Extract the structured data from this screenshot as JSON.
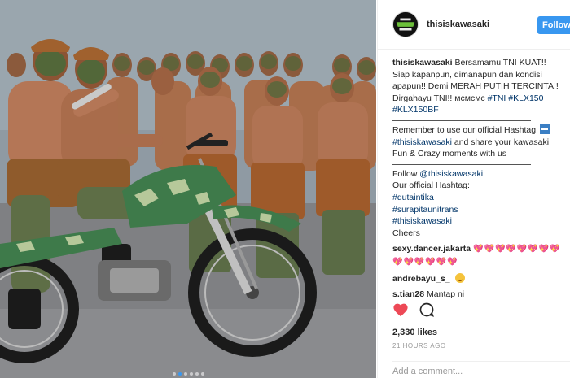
{
  "post": {
    "username": "thisiskawasaki",
    "follow_label": "Follow",
    "avatar_text": "thisis KAWASAKI",
    "caption_user": "thisiskawasaki",
    "caption_text": "Bersamamu TNI KUAT!! Siap kapanpun, dimanapun dan kondisi apapun!! Demi MERAH PUTIH TERCINTA!! Dirgahayu TNI!! мсмсмс ",
    "caption_tags": [
      "#TNI",
      "#KLX150",
      "#KLX150BF"
    ],
    "remember_text": "Remember to use our official Hashtag",
    "remember_tag": "#thisiskawasaki",
    "remember_rest": "and share your kawasaki Fun & Crazy moments with us",
    "follow_line_prefix": "Follow",
    "follow_line_handle": "@thisiskawasaki",
    "hashtag_title": "Our official Hashtag:",
    "official_tags": [
      "#dutaintika",
      "#surapitaunitrans",
      "#thisiskawasaki"
    ],
    "cheers": "Cheers"
  },
  "comments": [
    {
      "user": "sexy.dancer.jakarta",
      "text": "💖💖💖💖💖💖💖💖💖💖💖💖💖💖",
      "type": "hearts"
    },
    {
      "user": "andrebayu_s_",
      "text": "😍",
      "type": "smile"
    },
    {
      "user": "s.tian28",
      "text": "Mantap ni",
      "type": "text"
    }
  ],
  "actions": {
    "like_icon": "heart-icon",
    "comment_icon": "comment-icon",
    "likes": "2,330 likes",
    "time": "21 HOURS AGO",
    "add_comment_placeholder": "Add a comment..."
  },
  "carousel": {
    "count": 6,
    "active": 1
  },
  "colors": {
    "accent": "#3897f0",
    "heart": "#ed4956",
    "hashtag": "#003569"
  }
}
